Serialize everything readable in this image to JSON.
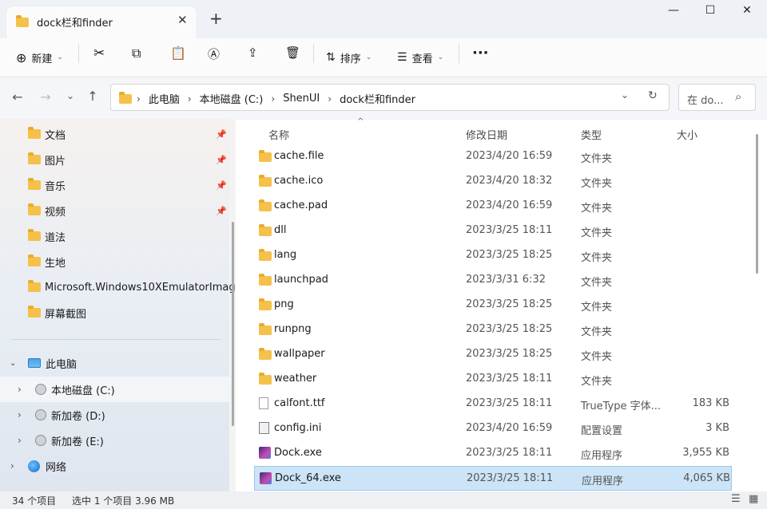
{
  "window": {
    "tab_title": "dock栏和finder",
    "close_tab": "✕",
    "new_tab": "+",
    "minimize": "—",
    "maximize": "☐",
    "close": "✕"
  },
  "toolbar": {
    "new_label": "新建",
    "sort_label": "排序",
    "view_label": "查看",
    "more": "···"
  },
  "address": {
    "crumbs": [
      "此电脑",
      "本地磁盘 (C:)",
      "ShenUI",
      "dock栏和finder"
    ],
    "search_placeholder": "在 do..."
  },
  "nav": {
    "quick": [
      {
        "label": "文档",
        "pinned": true
      },
      {
        "label": "图片",
        "pinned": true
      },
      {
        "label": "音乐",
        "pinned": true
      },
      {
        "label": "视频",
        "pinned": true
      },
      {
        "label": "道法",
        "pinned": false
      },
      {
        "label": "生地",
        "pinned": false
      },
      {
        "label": "Microsoft.Windows10XEmulatorImag",
        "pinned": false
      },
      {
        "label": "屏幕截图",
        "pinned": false
      }
    ],
    "this_pc": "此电脑",
    "drives": [
      "本地磁盘 (C:)",
      "新加卷 (D:)",
      "新加卷 (E:)"
    ],
    "network": "网络"
  },
  "columns": {
    "name": "名称",
    "date": "修改日期",
    "type": "类型",
    "size": "大小"
  },
  "files": [
    {
      "name": "cache.file",
      "date": "2023/4/20 16:59",
      "type": "文件夹",
      "size": "",
      "icon": "folder"
    },
    {
      "name": "cache.ico",
      "date": "2023/4/20 18:32",
      "type": "文件夹",
      "size": "",
      "icon": "folder"
    },
    {
      "name": "cache.pad",
      "date": "2023/4/20 16:59",
      "type": "文件夹",
      "size": "",
      "icon": "folder"
    },
    {
      "name": "dll",
      "date": "2023/3/25 18:11",
      "type": "文件夹",
      "size": "",
      "icon": "folder"
    },
    {
      "name": "lang",
      "date": "2023/3/25 18:25",
      "type": "文件夹",
      "size": "",
      "icon": "folder"
    },
    {
      "name": "launchpad",
      "date": "2023/3/31 6:32",
      "type": "文件夹",
      "size": "",
      "icon": "folder"
    },
    {
      "name": "png",
      "date": "2023/3/25 18:25",
      "type": "文件夹",
      "size": "",
      "icon": "folder"
    },
    {
      "name": "runpng",
      "date": "2023/3/25 18:25",
      "type": "文件夹",
      "size": "",
      "icon": "folder"
    },
    {
      "name": "wallpaper",
      "date": "2023/3/25 18:25",
      "type": "文件夹",
      "size": "",
      "icon": "folder"
    },
    {
      "name": "weather",
      "date": "2023/3/25 18:11",
      "type": "文件夹",
      "size": "",
      "icon": "folder"
    },
    {
      "name": "calfont.ttf",
      "date": "2023/3/25 18:11",
      "type": "TrueType 字体...",
      "size": "183 KB",
      "icon": "font"
    },
    {
      "name": "config.ini",
      "date": "2023/4/20 16:59",
      "type": "配置设置",
      "size": "3 KB",
      "icon": "ini"
    },
    {
      "name": "Dock.exe",
      "date": "2023/3/25 18:11",
      "type": "应用程序",
      "size": "3,955 KB",
      "icon": "exe"
    },
    {
      "name": "Dock_64.exe",
      "date": "2023/3/25 18:11",
      "type": "应用程序",
      "size": "4,065 KB",
      "icon": "exe",
      "selected": true
    }
  ],
  "status": {
    "count": "34 个项目",
    "selection": "选中 1 个项目  3.96 MB"
  }
}
